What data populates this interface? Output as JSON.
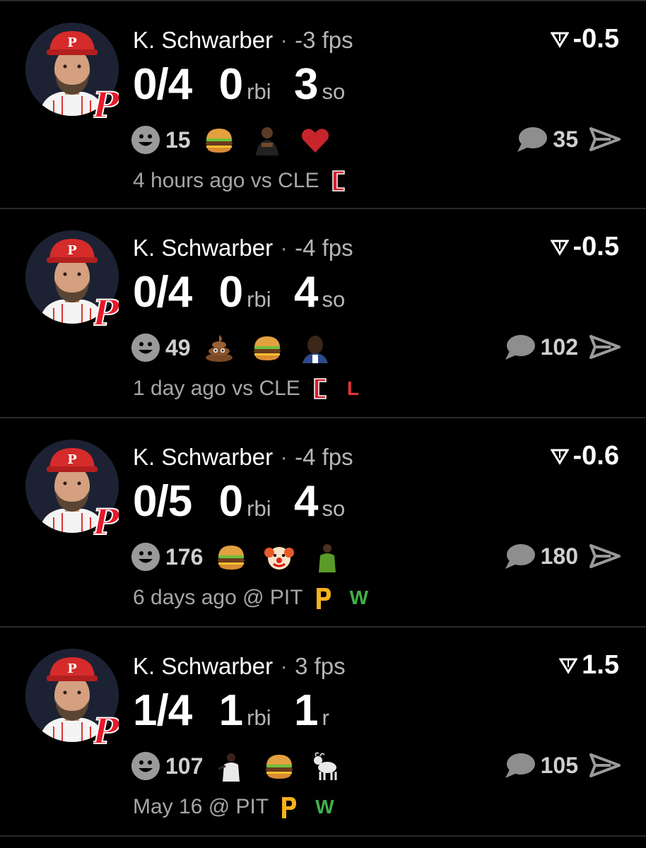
{
  "colors": {
    "background": "#000000",
    "win": "#3fb04a",
    "loss": "#e03434",
    "cle": "#d51f2e",
    "pit": "#f5b21a",
    "phillies": "#e81828"
  },
  "posts": [
    {
      "player": "K. Schwarber",
      "separator": "·",
      "fps": "-3 fps",
      "delta": "-0.5",
      "stats": [
        {
          "value": "0/4",
          "unit": ""
        },
        {
          "value": "0",
          "unit": "rbi"
        },
        {
          "value": "3",
          "unit": "so"
        }
      ],
      "reaction_count": "15",
      "emojis": [
        "burger-emoji",
        "signing-man-emoji",
        "red-heart-emoji"
      ],
      "comment_count": "35",
      "time": "4 hours ago vs CLE",
      "team_logo": "cle-logo",
      "result": ""
    },
    {
      "player": "K. Schwarber",
      "separator": "·",
      "fps": "-4 fps",
      "delta": "-0.5",
      "stats": [
        {
          "value": "0/4",
          "unit": ""
        },
        {
          "value": "0",
          "unit": "rbi"
        },
        {
          "value": "4",
          "unit": "so"
        }
      ],
      "reaction_count": "49",
      "emojis": [
        "poop-emoji",
        "burger-emoji",
        "man-face-emoji"
      ],
      "comment_count": "102",
      "time": "1 day ago vs CLE",
      "team_logo": "cle-logo",
      "result": "L"
    },
    {
      "player": "K. Schwarber",
      "separator": "·",
      "fps": "-4 fps",
      "delta": "-0.6",
      "stats": [
        {
          "value": "0/5",
          "unit": ""
        },
        {
          "value": "0",
          "unit": "rbi"
        },
        {
          "value": "4",
          "unit": "so"
        }
      ],
      "reaction_count": "176",
      "emojis": [
        "burger-emoji",
        "clown-emoji",
        "goalkeeper-emoji"
      ],
      "comment_count": "180",
      "time": "6 days ago @ PIT",
      "team_logo": "pit-logo",
      "result": "W"
    },
    {
      "player": "K. Schwarber",
      "separator": "·",
      "fps": "3 fps",
      "delta": "1.5",
      "stats": [
        {
          "value": "1/4",
          "unit": ""
        },
        {
          "value": "1",
          "unit": "rbi"
        },
        {
          "value": "1",
          "unit": "r"
        }
      ],
      "reaction_count": "107",
      "emojis": [
        "golfer-emoji",
        "burger-emoji",
        "goat-emoji"
      ],
      "comment_count": "105",
      "time": "May 16 @ PIT",
      "team_logo": "pit-logo",
      "result": "W"
    }
  ]
}
